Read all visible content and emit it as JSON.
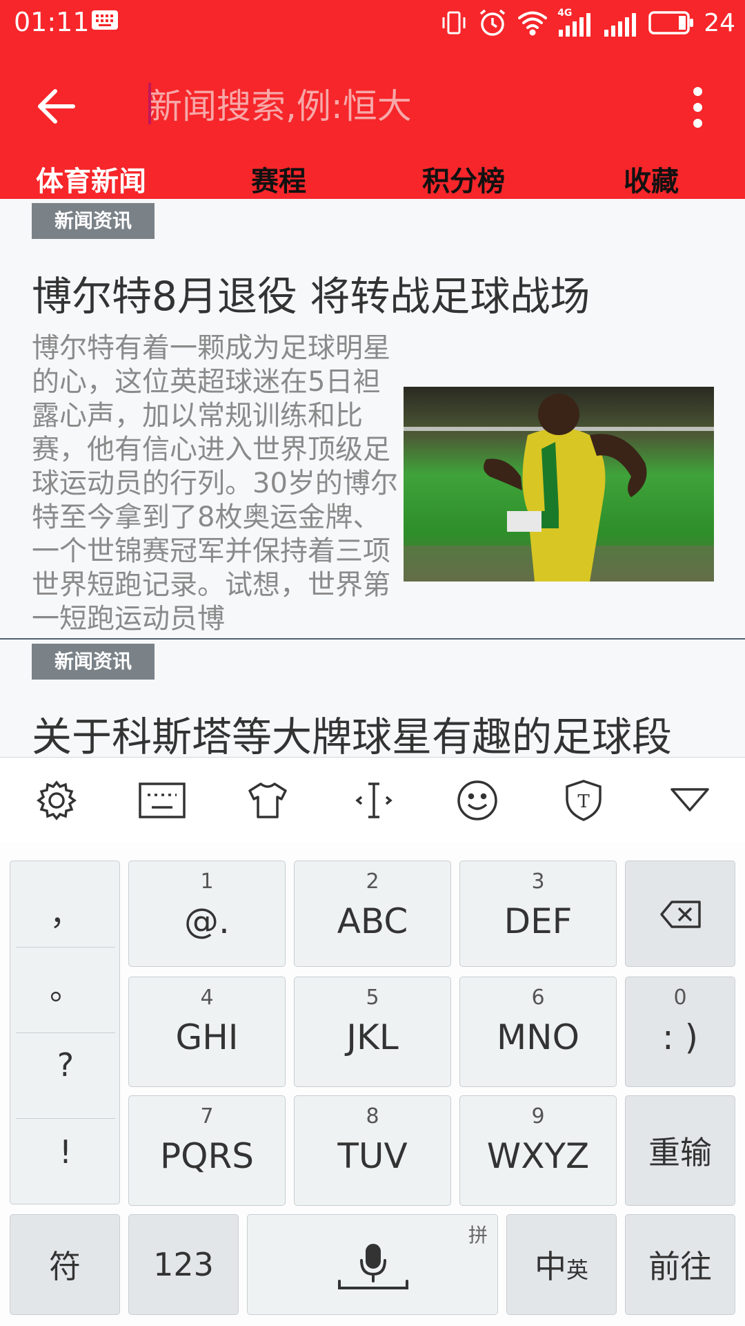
{
  "status_bar": {
    "time": "01:11",
    "battery_level": "24",
    "network_label": "4G",
    "icons": [
      "keyboard-icon",
      "vibrate-icon",
      "alarm-icon",
      "wifi-icon",
      "signal-4g-icon",
      "signal-icon",
      "battery-icon"
    ]
  },
  "app_bar": {
    "search_placeholder": "新闻搜索,例:恒大",
    "search_value": "",
    "back_icon": "arrow-back-icon",
    "more_icon": "more-vertical-icon",
    "color": "#f6262a"
  },
  "tabs": [
    {
      "label": "体育新闻",
      "active": true
    },
    {
      "label": "赛程",
      "active": false
    },
    {
      "label": "积分榜",
      "active": false
    },
    {
      "label": "收藏",
      "active": false
    }
  ],
  "feed": {
    "items": [
      {
        "badge": "新闻资讯",
        "title": "博尔特8月退役 将转战足球战场",
        "summary": "博尔特有着一颗成为足球明星的心，这位英超球迷在5日袒露心声，加以常规训练和比赛，他有信心进入世界顶级足球运动员的行列。30岁的博尔特至今拿到了8枚奥运金牌、一个世锦赛冠军并保持着三项世界短跑记录。试想，世界第一短跑运动员博",
        "photo": "sprinter-photo"
      },
      {
        "badge": "新闻资讯",
        "title": "关于科斯塔等大牌球星有趣的足球段"
      }
    ]
  },
  "keyboard": {
    "toolbar": [
      "settings-icon",
      "keyboard-layout-icon",
      "skin-shirt-icon",
      "cursor-move-icon",
      "emoji-icon",
      "font-shield-icon",
      "collapse-triangle-icon"
    ],
    "punctuation": [
      "，",
      "。",
      "?",
      "!"
    ],
    "rows": [
      [
        {
          "num": "1",
          "letters": "@."
        },
        {
          "num": "2",
          "letters": "ABC"
        },
        {
          "num": "3",
          "letters": "DEF"
        }
      ],
      [
        {
          "num": "4",
          "letters": "GHI"
        },
        {
          "num": "5",
          "letters": "JKL"
        },
        {
          "num": "6",
          "letters": "MNO"
        }
      ],
      [
        {
          "num": "7",
          "letters": "PQRS"
        },
        {
          "num": "8",
          "letters": "TUV"
        },
        {
          "num": "9",
          "letters": "WXYZ"
        }
      ]
    ],
    "smiley_key": {
      "num": "0",
      "label": ": )"
    },
    "retype": "重输",
    "symbols": "符",
    "numbers": "123",
    "space_hint": "拼",
    "lang_main": "中",
    "lang_sub": "英",
    "go": "前往"
  }
}
